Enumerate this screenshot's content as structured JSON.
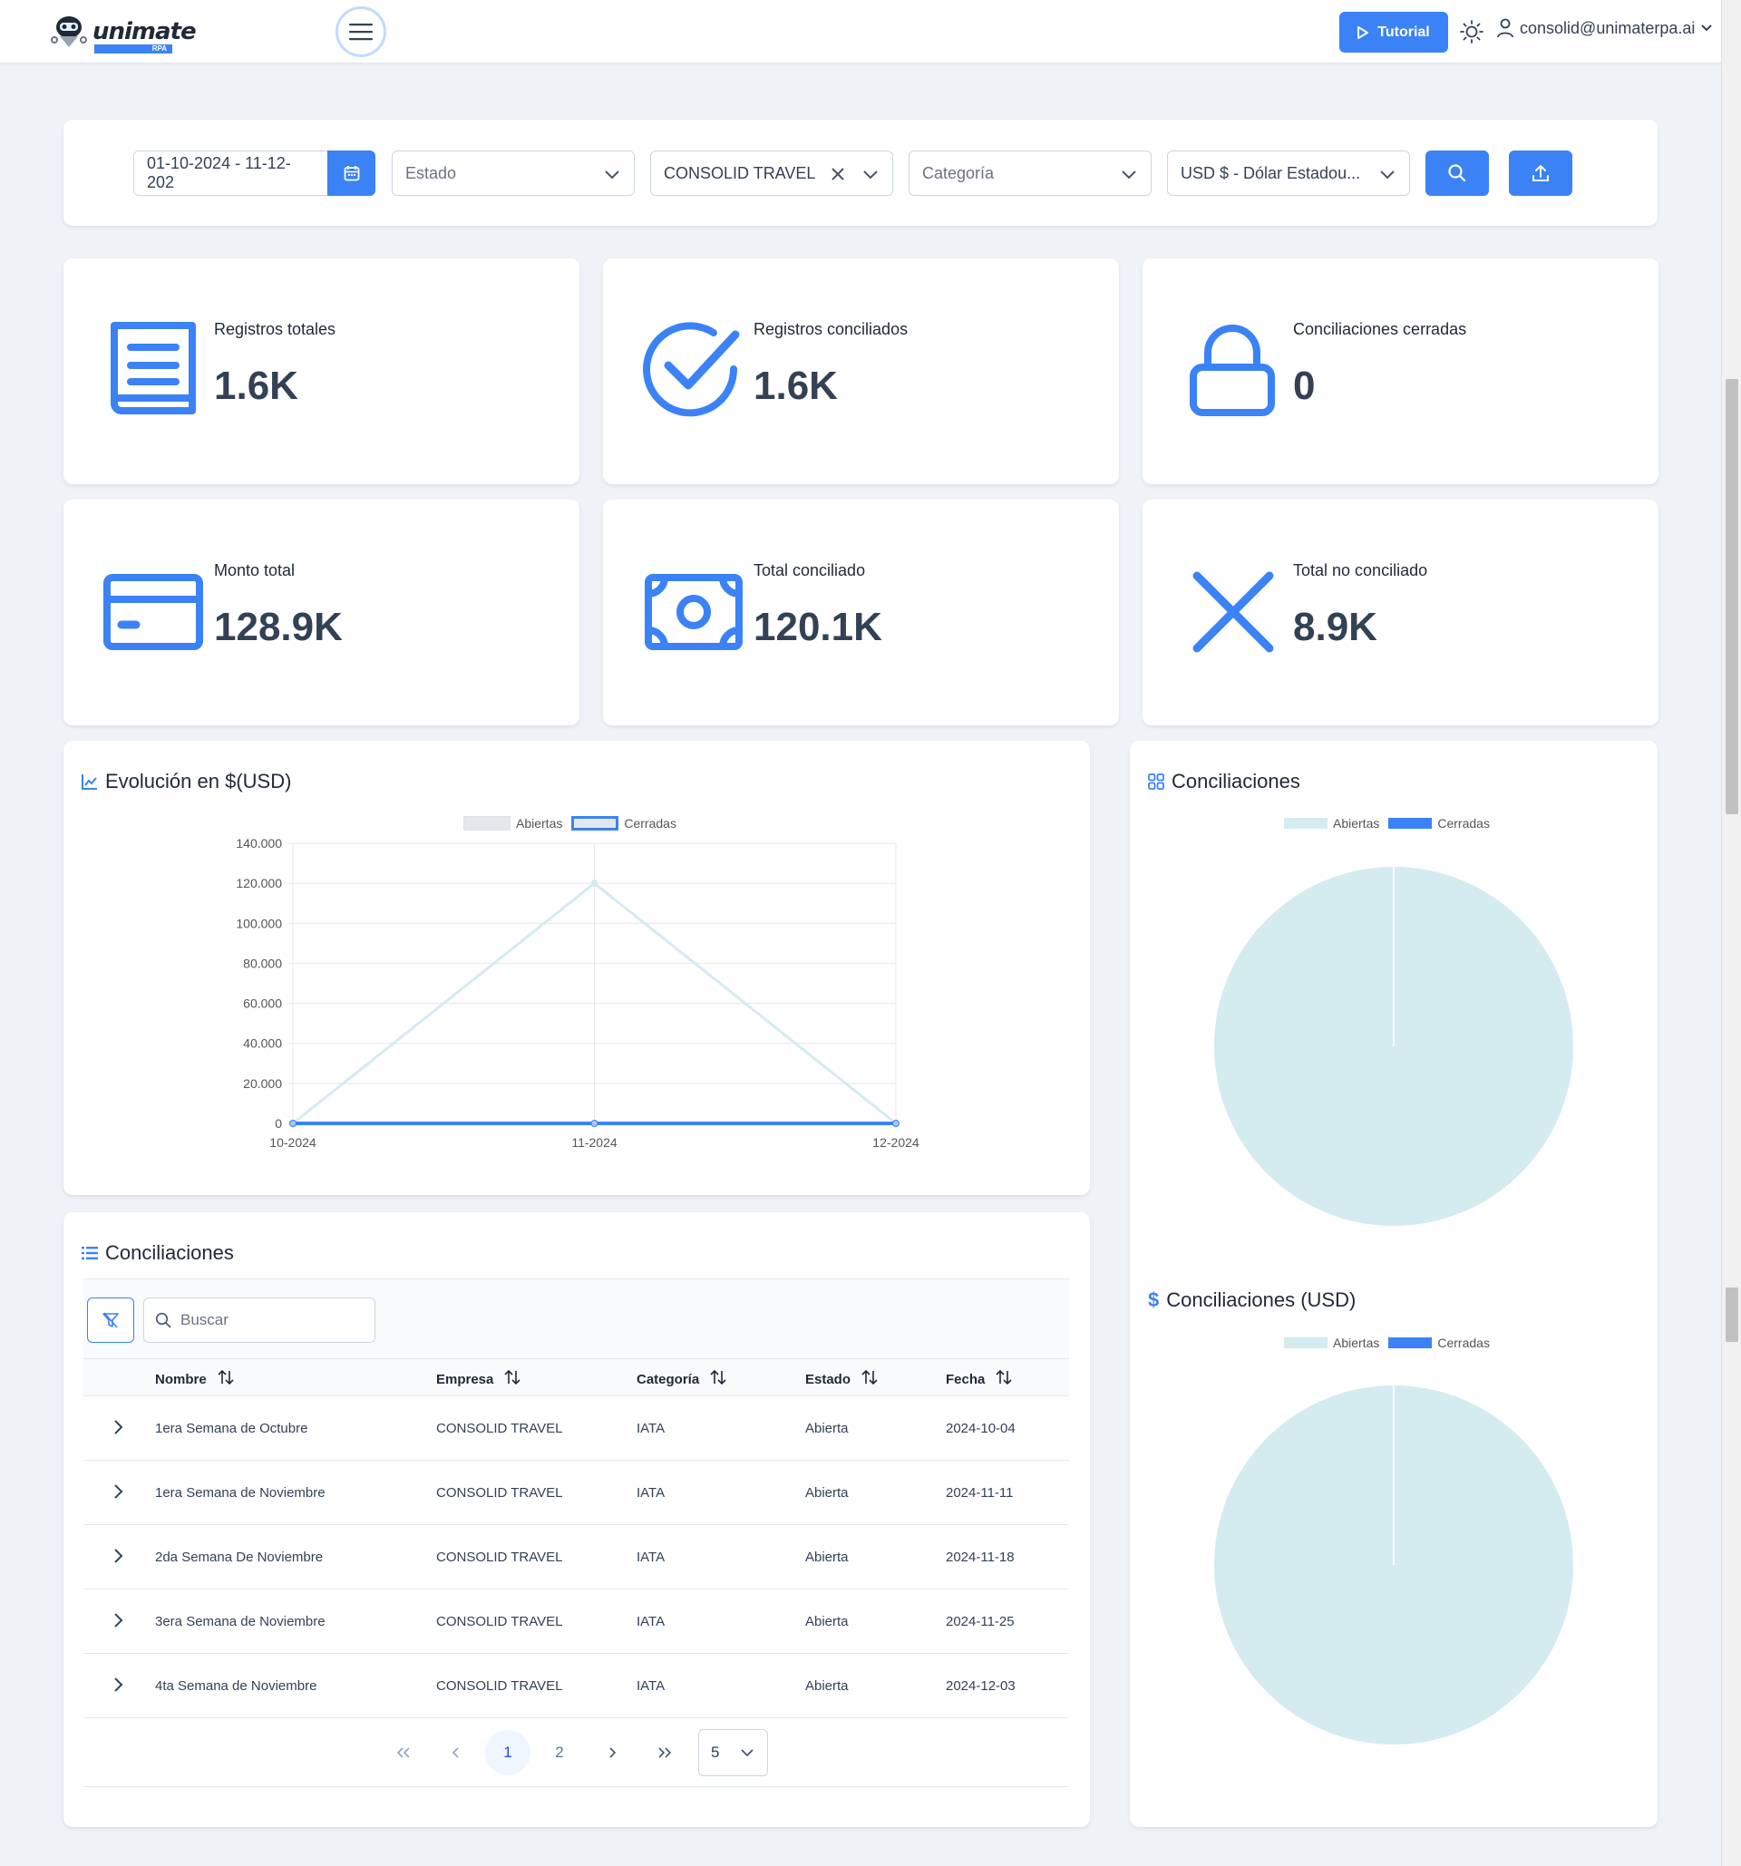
{
  "header": {
    "brand": "unimate",
    "brand_sub": "RPA",
    "tutorial_label": "Tutorial",
    "user_email": "consolid@unimaterpa.ai"
  },
  "filters": {
    "date_range": "01-10-2024 - 11-12-202",
    "estado_placeholder": "Estado",
    "empresa_value": "CONSOLID TRAVEL",
    "categoria_placeholder": "Categoría",
    "moneda_value": "USD $ - Dólar Estadou..."
  },
  "stats": [
    {
      "label": "Registros totales",
      "value": "1.6K",
      "icon": "document-icon"
    },
    {
      "label": "Registros conciliados",
      "value": "1.6K",
      "icon": "check-circle-icon"
    },
    {
      "label": "Conciliaciones cerradas",
      "value": "0",
      "icon": "lock-icon"
    },
    {
      "label": "Monto total",
      "value": "128.9K",
      "icon": "credit-card-icon"
    },
    {
      "label": "Total conciliado",
      "value": "120.1K",
      "icon": "money-icon"
    },
    {
      "label": "Total no conciliado",
      "value": "8.9K",
      "icon": "x-icon"
    }
  ],
  "line_panel": {
    "title": "Evolución en $(USD)"
  },
  "pie_panel": {
    "title": "Conciliaciones",
    "title_usd": "Conciliaciones (USD)"
  },
  "table_panel": {
    "title": "Conciliaciones",
    "search_placeholder": "Buscar",
    "columns": [
      "Nombre",
      "Empresa",
      "Categoría",
      "Estado",
      "Fecha"
    ],
    "rows": [
      [
        "1era Semana de Octubre",
        "CONSOLID TRAVEL",
        "IATA",
        "Abierta",
        "2024-10-04"
      ],
      [
        "1era Semana de Noviembre",
        "CONSOLID TRAVEL",
        "IATA",
        "Abierta",
        "2024-11-11"
      ],
      [
        "2da Semana De Noviembre",
        "CONSOLID TRAVEL",
        "IATA",
        "Abierta",
        "2024-11-18"
      ],
      [
        "3era Semana de Noviembre",
        "CONSOLID TRAVEL",
        "IATA",
        "Abierta",
        "2024-11-25"
      ],
      [
        "4ta Semana de Noviembre",
        "CONSOLID TRAVEL",
        "IATA",
        "Abierta",
        "2024-12-03"
      ]
    ],
    "pages": [
      "1",
      "2"
    ],
    "rows_per_page": "5"
  },
  "colors": {
    "accent": "#3b82f6",
    "abiertas": "#d4ebf0",
    "cerradas": "#3b82f6"
  },
  "chart_data": [
    {
      "type": "line",
      "categories": [
        "10-2024",
        "11-2024",
        "12-2024"
      ],
      "series": [
        {
          "name": "Abiertas",
          "values": [
            0,
            120000,
            0
          ]
        },
        {
          "name": "Cerradas",
          "values": [
            0,
            0,
            0
          ]
        }
      ],
      "y_ticks": [
        "0",
        "20.000",
        "40.000",
        "60.000",
        "80.000",
        "100.000",
        "120.000",
        "140.000"
      ],
      "ylim": [
        0,
        140000
      ],
      "grid": true,
      "legend": "top-center"
    },
    {
      "type": "pie",
      "labels": [
        "Abiertas",
        "Cerradas"
      ],
      "values": [
        100,
        0
      ],
      "legend": "top-center"
    },
    {
      "type": "pie",
      "labels": [
        "Abiertas",
        "Cerradas"
      ],
      "values": [
        100,
        0
      ],
      "legend": "top-center"
    }
  ]
}
